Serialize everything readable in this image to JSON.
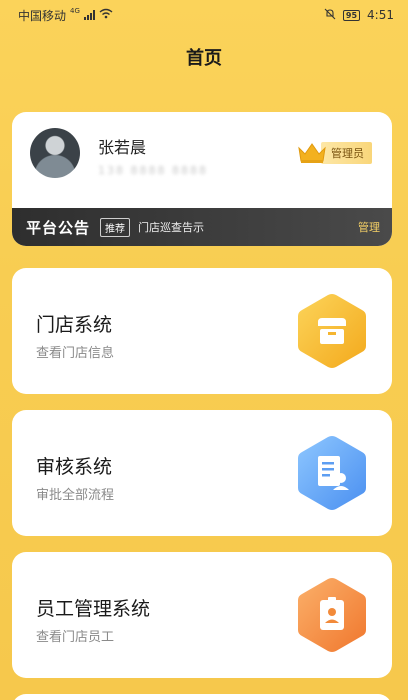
{
  "status": {
    "carrier": "中国移动",
    "signal_tag": "4G",
    "battery": "95",
    "time": "4:51"
  },
  "page": {
    "title": "首页"
  },
  "profile": {
    "name": "张若晨",
    "phone": "138 8888 8888",
    "role": "管理员",
    "icons": {
      "avatar": "user-avatar",
      "crown": "crown-icon"
    }
  },
  "notice": {
    "title": "平台公告",
    "tag": "推荐",
    "text": "门店巡查告示",
    "manage": "管理"
  },
  "systems": [
    {
      "title": "门店系统",
      "subtitle": "查看门店信息",
      "icon": "store-icon",
      "color_from": "#fcd45a",
      "color_to": "#f3a91c"
    },
    {
      "title": "审核系统",
      "subtitle": "审批全部流程",
      "icon": "document-user-icon",
      "color_from": "#8ec7ff",
      "color_to": "#4a8ff0"
    },
    {
      "title": "员工管理系统",
      "subtitle": "查看门店员工",
      "icon": "badge-icon",
      "color_from": "#fbb06a",
      "color_to": "#f0772d"
    }
  ]
}
